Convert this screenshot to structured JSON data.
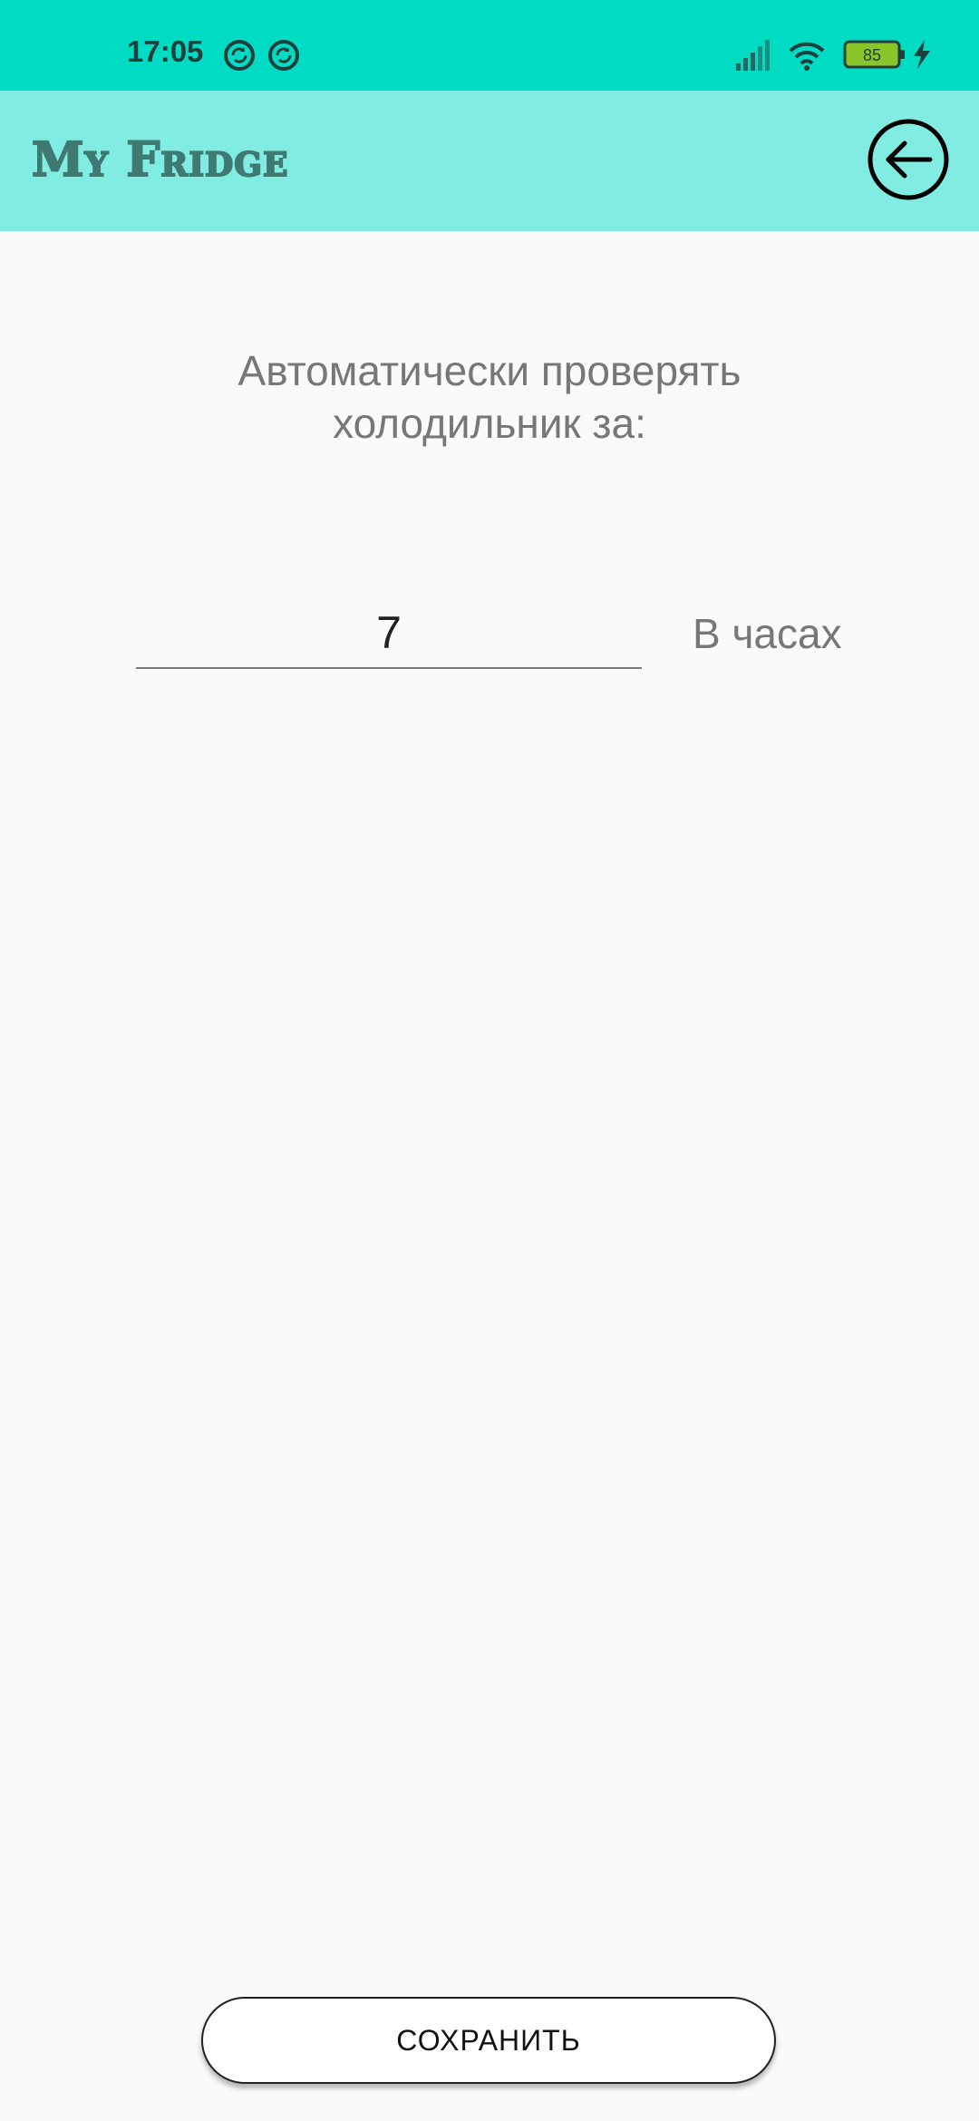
{
  "status_bar": {
    "time": "17:05",
    "battery_level": "85",
    "icons": [
      "sync-icon",
      "sync-icon",
      "signal-icon",
      "wifi-icon",
      "battery-icon",
      "charging-icon"
    ]
  },
  "app_bar": {
    "title": "My Fridge",
    "back_icon": "arrow-left-circle-icon"
  },
  "main": {
    "prompt_line1": "Автоматически проверять",
    "prompt_line2": "холодильник за:",
    "hours_value": "7",
    "hours_unit": "В часах"
  },
  "footer": {
    "save_label": "СОХРАНИТЬ"
  },
  "colors": {
    "status_bar": "#00dcc4",
    "app_bar": "#80ece2",
    "title": "#3f7a72",
    "background": "#fafafa"
  }
}
